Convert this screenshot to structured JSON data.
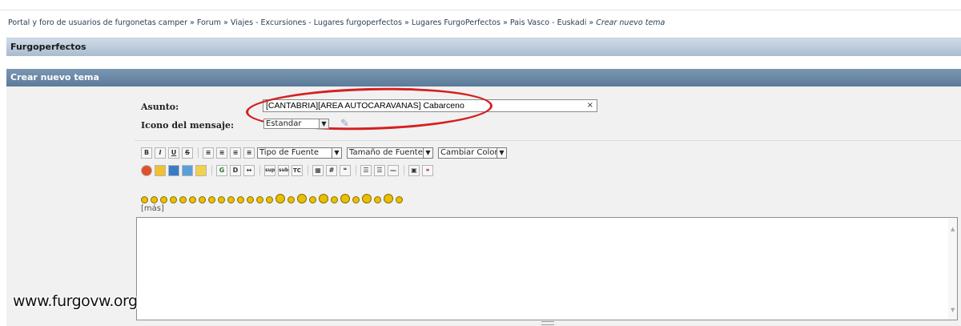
{
  "breadcrumb": {
    "items": [
      "Portal y foro de usuarios de furgonetas camper",
      "Forum",
      "Viajes - Excursiones - Lugares furgoperfectos",
      "Lugares FurgoPerfectos",
      "Pais Vasco - Euskadi"
    ],
    "separator": "»",
    "current": "Crear nuevo tema"
  },
  "forum_header": {
    "title": "Furgoperfectos"
  },
  "form_header": {
    "title": "Crear nuevo tema"
  },
  "form": {
    "subject_label": "Asunto:",
    "subject_value": "[CANTABRIA][AREA AUTOCARAVANAS] Cabarceno",
    "clear_glyph": "×",
    "icon_label": "Icono del mensaje:",
    "icon_value": "Estandar"
  },
  "toolbar": {
    "format_buttons": [
      "B",
      "I",
      "U",
      "S"
    ],
    "align_buttons": [
      "align-left",
      "align-center",
      "align-right",
      "justify"
    ],
    "font_select": "Tipo de Fuente",
    "size_select": "Tamaño de Fuente",
    "color_select": "Cambiar Color",
    "row2_buttons": [
      "flash",
      "youtube",
      "google-video",
      "refresh",
      "smile",
      "G",
      "D",
      "AM",
      "sup",
      "sub",
      "TC",
      "table",
      "#",
      "quote",
      "list",
      "ordered-list",
      "hr",
      "image",
      "link"
    ]
  },
  "smilies_count": 26,
  "more_link": "[más]",
  "message_body": "",
  "watermark": "www.furgovw.org",
  "colors": {
    "highlight_oval": "#d61f1f",
    "header_band": "#6a88a6",
    "panel_bg": "#f1f1f1"
  }
}
